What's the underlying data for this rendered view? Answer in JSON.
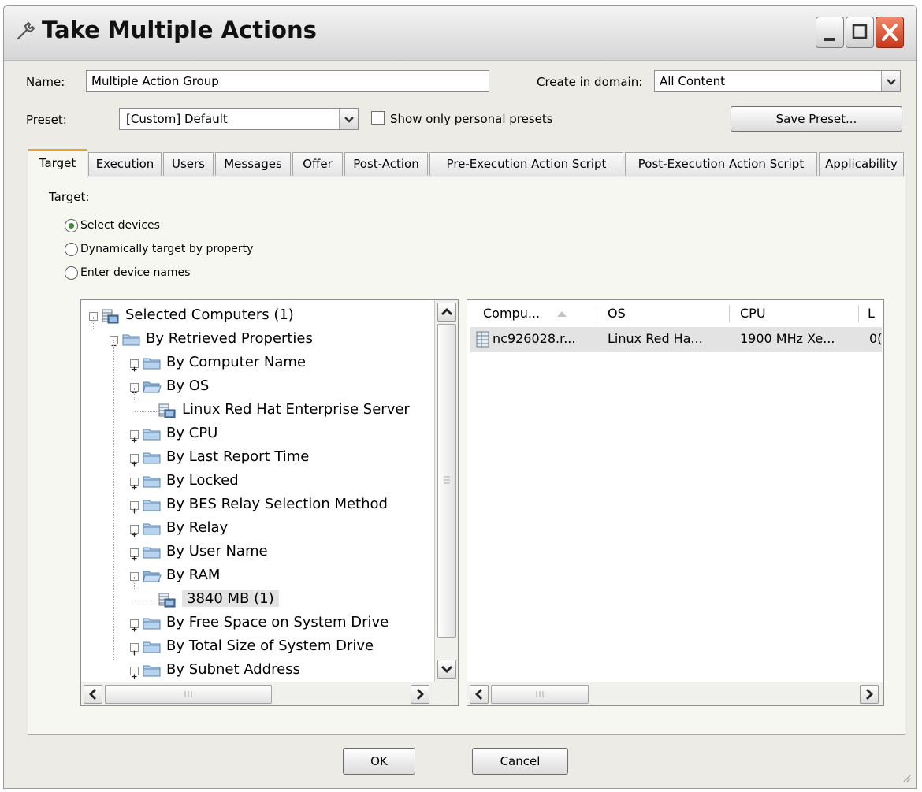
{
  "window": {
    "title": "Take Multiple Actions",
    "icon": "wrench-icon"
  },
  "form": {
    "name_label": "Name:",
    "name_value": "Multiple Action Group",
    "domain_label": "Create in domain:",
    "domain_value": "All Content",
    "preset_label": "Preset:",
    "preset_value": "[Custom] Default",
    "personal_presets_label": "Show only personal presets",
    "personal_presets_checked": false,
    "save_preset_label": "Save Preset..."
  },
  "tabs": [
    {
      "label": "Target",
      "active": true
    },
    {
      "label": "Execution"
    },
    {
      "label": "Users"
    },
    {
      "label": "Messages"
    },
    {
      "label": "Offer"
    },
    {
      "label": "Post-Action"
    },
    {
      "label": "Pre-Execution Action Script"
    },
    {
      "label": "Post-Execution Action Script"
    },
    {
      "label": "Applicability"
    }
  ],
  "target": {
    "heading": "Target:",
    "options": [
      {
        "label": "Select devices",
        "selected": true
      },
      {
        "label": "Dynamically target by property",
        "selected": false
      },
      {
        "label": "Enter device names",
        "selected": false
      }
    ]
  },
  "tree": {
    "items": [
      {
        "label": "Selected Computers (1)",
        "icon": "computer-group-icon",
        "expander": "minus"
      },
      {
        "label": "By Retrieved Properties",
        "icon": "folder-icon",
        "expander": "minus"
      },
      {
        "label": "By Computer Name",
        "icon": "folder-icon",
        "expander": "plus"
      },
      {
        "label": "By OS",
        "icon": "folder-open-icon",
        "expander": "minus"
      },
      {
        "label": "Linux Red Hat Enterprise Server",
        "icon": "computer-group-icon",
        "expander": ""
      },
      {
        "label": "By CPU",
        "icon": "folder-icon",
        "expander": "plus"
      },
      {
        "label": "By Last Report Time",
        "icon": "folder-icon",
        "expander": "plus"
      },
      {
        "label": "By Locked",
        "icon": "folder-icon",
        "expander": "plus"
      },
      {
        "label": "By BES Relay Selection Method",
        "icon": "folder-icon",
        "expander": "plus"
      },
      {
        "label": "By Relay",
        "icon": "folder-icon",
        "expander": "plus"
      },
      {
        "label": "By User Name",
        "icon": "folder-icon",
        "expander": "plus"
      },
      {
        "label": "By RAM",
        "icon": "folder-open-icon",
        "expander": "minus"
      },
      {
        "label": "3840 MB (1)",
        "icon": "computer-group-icon",
        "expander": "",
        "selected": true
      },
      {
        "label": "By Free Space on System Drive",
        "icon": "folder-icon",
        "expander": "plus"
      },
      {
        "label": "By Total Size of System Drive",
        "icon": "folder-icon",
        "expander": "plus"
      },
      {
        "label": "By Subnet Address",
        "icon": "folder-icon",
        "expander": "plus"
      }
    ]
  },
  "list": {
    "columns": [
      "Compu...",
      "OS",
      "CPU",
      "L"
    ],
    "rows": [
      {
        "computer": "nc926028.r...",
        "os": "Linux Red Ha...",
        "cpu": "1900 MHz Xe...",
        "last": "0("
      }
    ]
  },
  "footer": {
    "ok_label": "OK",
    "cancel_label": "Cancel"
  },
  "colors": {
    "active_tab_accent": "#f0a030",
    "selected_row": "#e3e3e3",
    "close_button": "#d9482a",
    "radio_dot": "#3a8a3a"
  }
}
